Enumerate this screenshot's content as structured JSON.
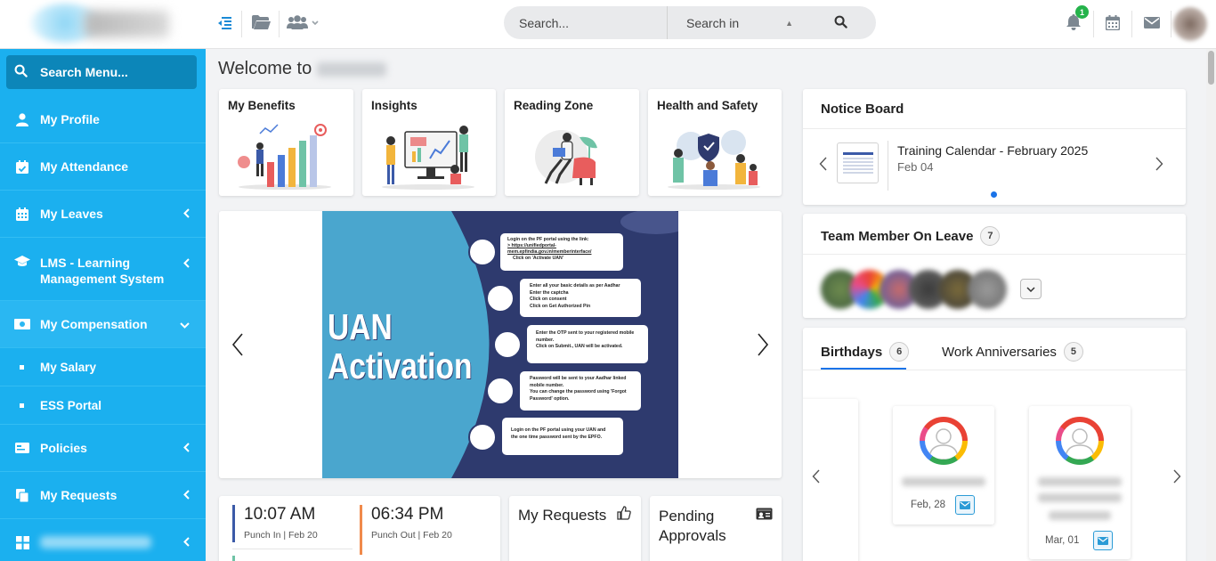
{
  "sidebar": {
    "search_label": "Search Menu...",
    "items": [
      {
        "label": "My Profile",
        "icon": "user-icon"
      },
      {
        "label": "My Attendance",
        "icon": "calendar-check-icon"
      },
      {
        "label": "My Leaves",
        "icon": "calendar-icon"
      },
      {
        "label": "LMS - Learning Management System",
        "label1": "LMS - Learning",
        "label2": "Management System",
        "icon": "graduation-cap-icon"
      },
      {
        "label": "My Compensation",
        "icon": "money-icon"
      },
      {
        "label": "My Salary"
      },
      {
        "label": "ESS Portal"
      },
      {
        "label": "Policies",
        "icon": "id-card-icon"
      },
      {
        "label": "My Requests",
        "icon": "copy-icon"
      }
    ]
  },
  "topbar": {
    "search_placeholder": "Search...",
    "search_in_label": "Search in",
    "notification_count": "1"
  },
  "welcome": {
    "text": "Welcome to"
  },
  "quick_cards": [
    {
      "title": "My Benefits"
    },
    {
      "title": "Insights"
    },
    {
      "title": "Reading Zone"
    },
    {
      "title": "Health and Safety"
    }
  ],
  "banner": {
    "title_line1": "UAN",
    "title_line2": "Activation",
    "steps": [
      {
        "b1": "Login on the PF portal using the link:",
        "b1b": "> https://unifiedportal-",
        "b1c": "mem.epfindia.gov.in/memberinterface/",
        "b2": "Click on 'Activate UAN'"
      },
      {
        "b1": "Enter all your basic details as per Aadhar",
        "b2": "Enter the captcha",
        "b3": "Click on consent",
        "b4": "Click on Get Authorized Pin"
      },
      {
        "b1": "Enter the OTP sent to your registered mobile",
        "b1b": "number.",
        "b2": "Click on Submit., UAN will be activated."
      },
      {
        "b1": "Password will be sent to your Aadhar linked",
        "b1b": "mobile number.",
        "b2": "You can change the password using 'Forgot",
        "b2b": "Password' option."
      },
      {
        "b1": "Login on the PF portal using your UAN and",
        "b1b": "the one time password sent by the EPFO."
      }
    ]
  },
  "punch": {
    "in_time": "10:07 AM",
    "in_label": "Punch In | Feb 20",
    "out_time": "06:34 PM",
    "out_label": "Punch Out | Feb 20"
  },
  "my_requests": {
    "title": "My Requests"
  },
  "pending": {
    "line1": "Pending",
    "line2": "Approvals"
  },
  "notice": {
    "title": "Notice Board",
    "item_title": "Training Calendar - February 2025",
    "item_date": "Feb 04"
  },
  "team_leave": {
    "title": "Team Member On Leave",
    "count": "7"
  },
  "celebrations": {
    "tab1": "Birthdays",
    "tab1_count": "6",
    "tab2": "Work Anniversaries",
    "tab2_count": "5",
    "people": [
      {
        "date": "Feb, 28"
      },
      {
        "date": "Mar, 01"
      }
    ]
  },
  "colors": {
    "sidebar": "#1bb0ef",
    "accent": "#1a73e8",
    "banner_blue": "#2e3a6e",
    "banner_light": "#4aa6ce"
  }
}
